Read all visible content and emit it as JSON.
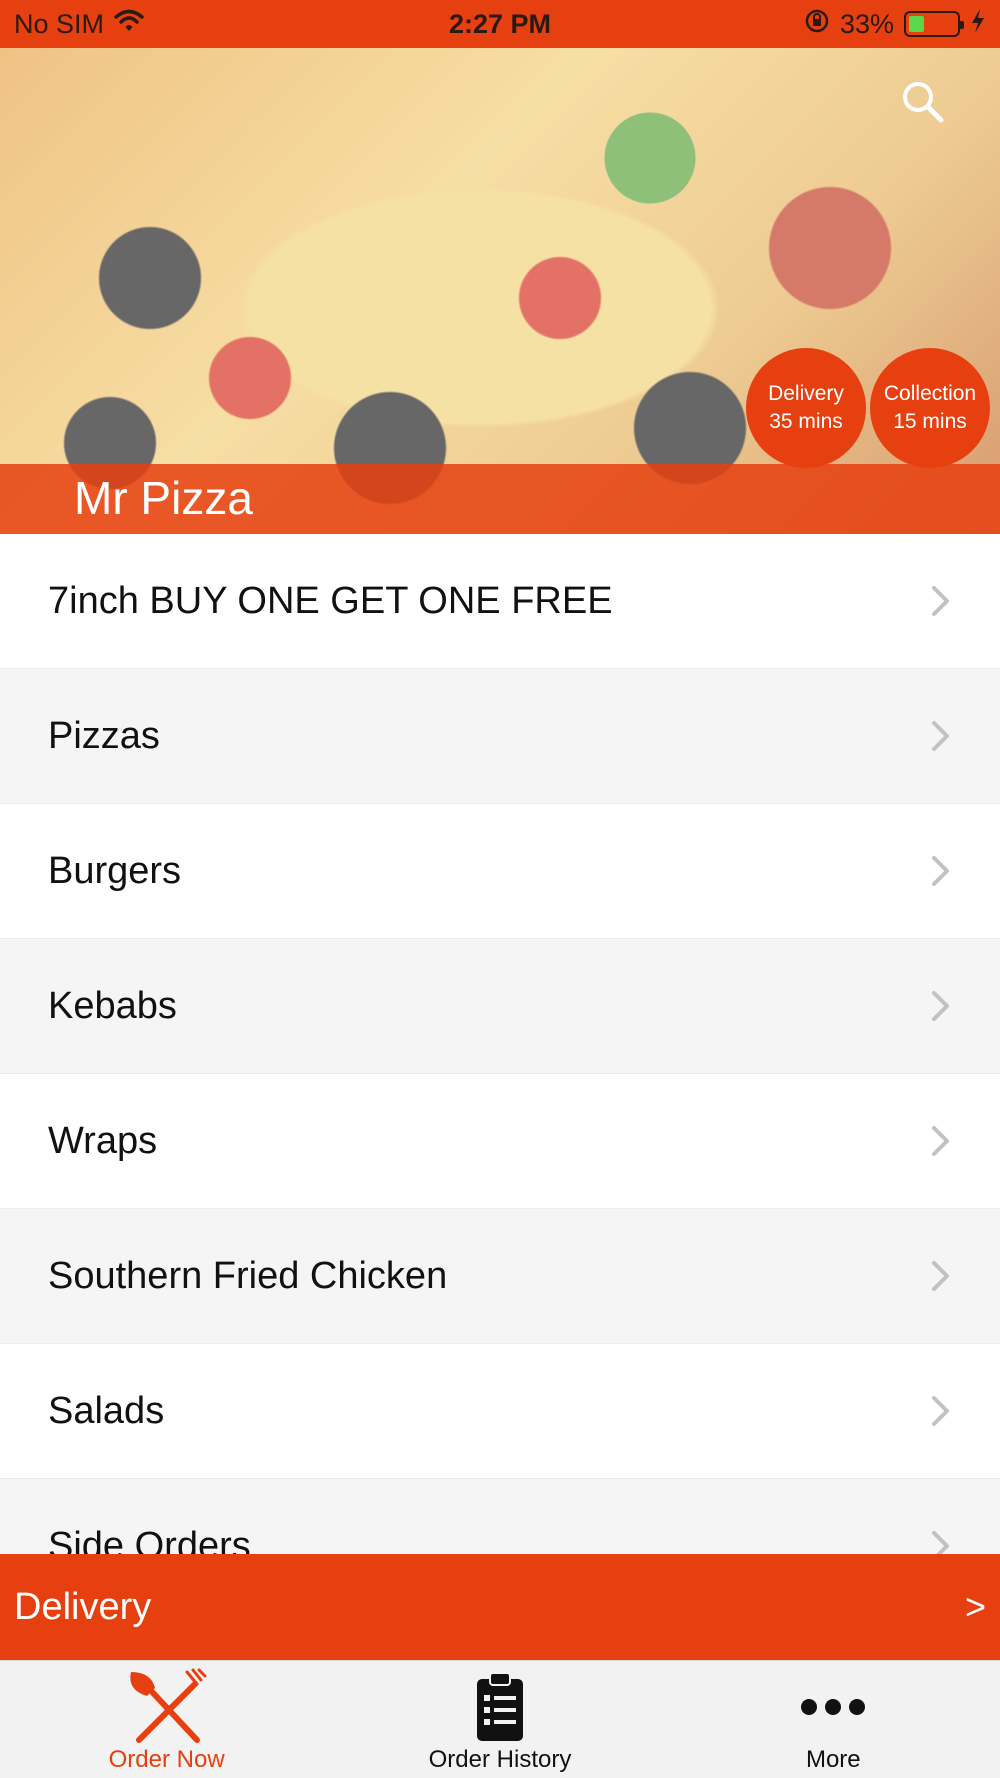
{
  "status_bar": {
    "carrier": "No SIM",
    "time": "2:27 PM",
    "battery_percent": "33%",
    "battery_level": 0.33,
    "icons": [
      "wifi-icon",
      "orientation-lock-icon",
      "battery-icon",
      "charging-bolt-icon"
    ]
  },
  "hero": {
    "restaurant_name": "Mr Pizza",
    "search_icon": "search-icon",
    "badges": [
      {
        "label": "Delivery",
        "time": "35 mins"
      },
      {
        "label": "Collection",
        "time": "15 mins"
      }
    ]
  },
  "categories": [
    {
      "label": "7inch BUY ONE GET ONE FREE"
    },
    {
      "label": "Pizzas"
    },
    {
      "label": "Burgers"
    },
    {
      "label": "Kebabs"
    },
    {
      "label": "Wraps"
    },
    {
      "label": "Southern Fried Chicken"
    },
    {
      "label": "Salads"
    },
    {
      "label": "Side Orders"
    }
  ],
  "order_bar": {
    "label": "Delivery",
    "arrow": ">"
  },
  "tab_bar": {
    "tabs": [
      {
        "label": "Order Now",
        "icon": "fork-knife-icon",
        "active": true
      },
      {
        "label": "Order History",
        "icon": "clipboard-icon",
        "active": false
      },
      {
        "label": "More",
        "icon": "more-dots-icon",
        "active": false
      }
    ]
  },
  "colors": {
    "accent": "#e64011",
    "row_alt": "#f5f5f5",
    "tab_bar_bg": "#f2f2f2"
  }
}
